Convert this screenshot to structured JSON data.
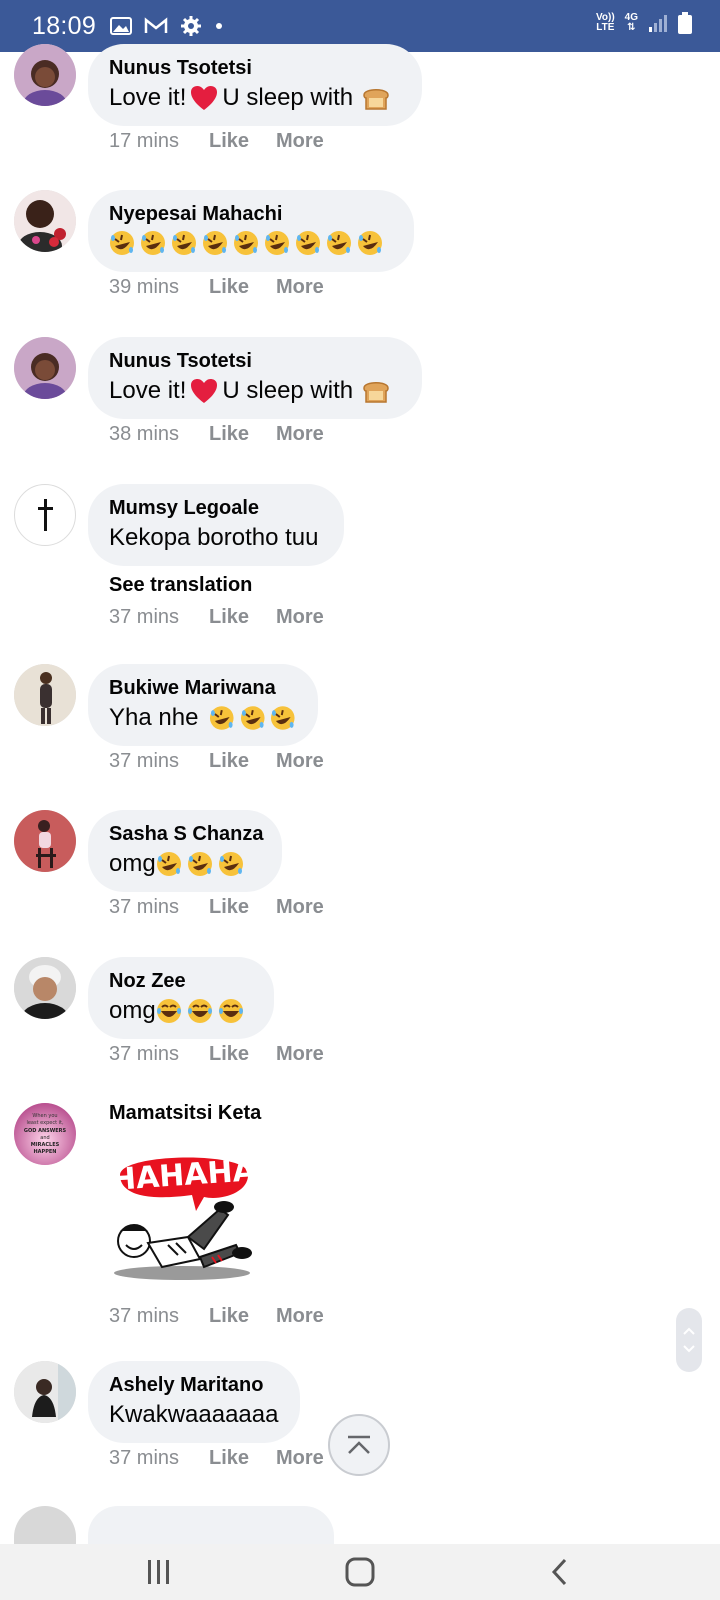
{
  "status_bar": {
    "time": "18:09",
    "icons_left": [
      "gallery-icon",
      "gmail-icon",
      "settings-icon",
      "notification-dot-icon"
    ],
    "network_top": "Vo))",
    "network_bottom": "LTE",
    "data_type": "4G",
    "icons_right": [
      "signal-icon",
      "battery-icon"
    ]
  },
  "actions": {
    "like": "Like",
    "more": "More"
  },
  "comments": [
    {
      "name": "Nunus Tsotetsi",
      "text_before": "Love it!",
      "text_after": "U sleep with",
      "time": "17 mins"
    },
    {
      "name": "Nyepesai Mahachi",
      "text": "",
      "emoji": "rolling-laughing-emoji x9",
      "time": "39 mins"
    },
    {
      "name": "Nunus Tsotetsi",
      "text_before": "Love it!",
      "text_after": "U sleep with",
      "time": "38 mins"
    },
    {
      "name": "Mumsy Legoale",
      "text": "Kekopa borotho tuu",
      "see_translation": "See translation",
      "time": "37 mins"
    },
    {
      "name": "Bukiwe Mariwana",
      "text": "Yha nhe",
      "emoji": "rolling-laughing-emoji x3",
      "time": "37 mins"
    },
    {
      "name": "Sasha S Chanza",
      "text": "omg",
      "emoji": "rolling-laughing-emoji x3",
      "time": "37 mins"
    },
    {
      "name": "Noz Zee",
      "text": "omg",
      "emoji": "tears-of-joy-emoji x3",
      "time": "37 mins"
    },
    {
      "name": "Mamatsitsi Keta",
      "sticker_text": "HAHAHA",
      "time": "37 mins"
    },
    {
      "name": "Ashely Maritano",
      "text": "Kwakwaaaaaaa",
      "time": "37 mins"
    }
  ],
  "avatar_caption": [
    "When you",
    "least expect it,",
    "GOD ANSWERS",
    "and",
    "MIRACLES",
    "HAPPEN"
  ],
  "colors": {
    "status_bar": "#3b5998",
    "bubble": "#f0f2f5",
    "meta_text": "#8a8d91",
    "heart": "#e41e3f",
    "emoji_yellow": "#f7c23a"
  },
  "nav_bar": {
    "icons": [
      "recent-apps-icon",
      "home-icon",
      "back-icon"
    ]
  }
}
